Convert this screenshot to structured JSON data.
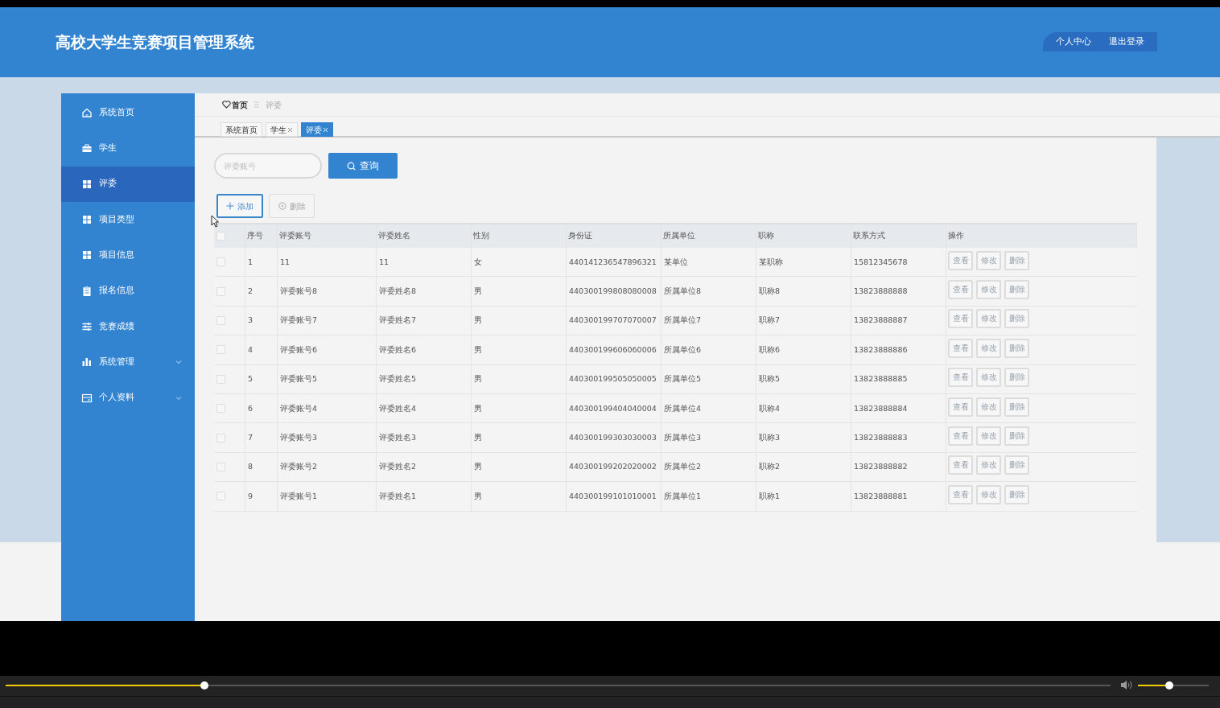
{
  "header": {
    "title": "高校大学生竞赛项目管理系统",
    "links": [
      "个人中心",
      "退出登录"
    ]
  },
  "sidebar": {
    "items": [
      {
        "label": "系统首页",
        "kind": "link",
        "selected": false
      },
      {
        "label": "学生",
        "kind": "link",
        "selected": false
      },
      {
        "label": "评委",
        "kind": "link",
        "selected": true
      },
      {
        "label": "项目类型",
        "kind": "link",
        "selected": false
      },
      {
        "label": "项目信息",
        "kind": "link",
        "selected": false
      },
      {
        "label": "报名信息",
        "kind": "link",
        "selected": false
      },
      {
        "label": "竞赛成绩",
        "kind": "link",
        "selected": false
      },
      {
        "label": "系统管理",
        "kind": "submenu",
        "selected": false
      },
      {
        "label": "个人资料",
        "kind": "submenu",
        "selected": false
      }
    ]
  },
  "breadcrumb": [
    "首页",
    "评委"
  ],
  "tabs": [
    {
      "label": "系统首页",
      "closable": false,
      "selected": false
    },
    {
      "label": "学生",
      "closable": true,
      "selected": false
    },
    {
      "label": "评委",
      "closable": true,
      "selected": true
    }
  ],
  "search": {
    "placeholder": "评委账号",
    "button": "查询"
  },
  "actions": [
    {
      "label": "添加",
      "kind": "add"
    },
    {
      "label": "删除",
      "kind": "delete"
    }
  ],
  "table": {
    "select_all": {
      "checked": false
    },
    "columns": [
      "序号",
      "评委账号",
      "评委姓名",
      "性别",
      "身份证",
      "所属单位",
      "职称",
      "联系方式",
      "操作"
    ],
    "rows": [
      {
        "checked": false,
        "cells": [
          "1",
          "11",
          "11",
          "女",
          "440141236547896321",
          "某单位",
          "某职称",
          "15812345678"
        ],
        "actions": [
          "查看",
          "修改",
          "删除"
        ]
      },
      {
        "checked": false,
        "cells": [
          "2",
          "评委账号8",
          "评委姓名8",
          "男",
          "440300199808080008",
          "所属单位8",
          "职称8",
          "13823888888"
        ],
        "actions": [
          "查看",
          "修改",
          "删除"
        ]
      },
      {
        "checked": false,
        "cells": [
          "3",
          "评委账号7",
          "评委姓名7",
          "男",
          "440300199707070007",
          "所属单位7",
          "职称7",
          "13823888887"
        ],
        "actions": [
          "查看",
          "修改",
          "删除"
        ]
      },
      {
        "checked": false,
        "cells": [
          "4",
          "评委账号6",
          "评委姓名6",
          "男",
          "440300199606060006",
          "所属单位6",
          "职称6",
          "13823888886"
        ],
        "actions": [
          "查看",
          "修改",
          "删除"
        ]
      },
      {
        "checked": false,
        "cells": [
          "5",
          "评委账号5",
          "评委姓名5",
          "男",
          "440300199505050005",
          "所属单位5",
          "职称5",
          "13823888885"
        ],
        "actions": [
          "查看",
          "修改",
          "删除"
        ]
      },
      {
        "checked": false,
        "cells": [
          "6",
          "评委账号4",
          "评委姓名4",
          "男",
          "440300199404040004",
          "所属单位4",
          "职称4",
          "13823888884"
        ],
        "actions": [
          "查看",
          "修改",
          "删除"
        ]
      },
      {
        "checked": false,
        "cells": [
          "7",
          "评委账号3",
          "评委姓名3",
          "男",
          "440300199303030003",
          "所属单位3",
          "职称3",
          "13823888883"
        ],
        "actions": [
          "查看",
          "修改",
          "删除"
        ]
      },
      {
        "checked": false,
        "cells": [
          "8",
          "评委账号2",
          "评委姓名2",
          "男",
          "440300199202020002",
          "所属单位2",
          "职称2",
          "13823888882"
        ],
        "actions": [
          "查看",
          "修改",
          "删除"
        ]
      },
      {
        "checked": false,
        "cells": [
          "9",
          "评委账号1",
          "评委姓名1",
          "男",
          "440300199101010001",
          "所属单位1",
          "职称1",
          "13823888881"
        ],
        "actions": [
          "查看",
          "修改",
          "删除"
        ]
      }
    ]
  },
  "player": {
    "progress": {
      "level": 0.18
    },
    "volume": {
      "level": 0.44
    }
  }
}
